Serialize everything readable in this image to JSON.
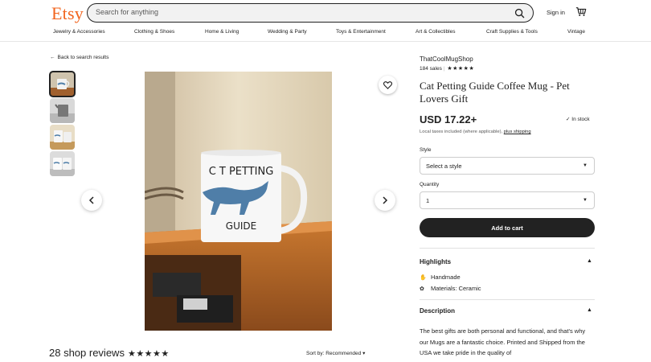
{
  "header": {
    "logo": "Etsy",
    "search_placeholder": "Search for anything",
    "sign_in": "Sign in"
  },
  "categories": [
    "Jewelry & Accessories",
    "Clothing & Shoes",
    "Home & Living",
    "Wedding & Party",
    "Toys & Entertainment",
    "Art & Collectibles",
    "Craft Supplies & Tools",
    "Vintage"
  ],
  "listing": {
    "back_link": "Back to search results",
    "thumbnails_count": 4,
    "mug_text_top": "C T PETTING",
    "mug_text_bottom": "GUIDE"
  },
  "reviews": {
    "title": "28 shop reviews",
    "stars": "★★★★★",
    "sort_label": "Sort by: Recommended"
  },
  "product": {
    "shop_name": "ThatCoolMugShop",
    "sales": "184 sales",
    "stars": "★★★★★",
    "title": "Cat Petting Guide Coffee Mug - Pet Lovers Gift",
    "price": "USD 17.22+",
    "in_stock": "In stock",
    "taxes_text": "Local taxes included (where applicable),",
    "shipping_link": "plus shipping",
    "style_label": "Style",
    "style_value": "Select a style",
    "quantity_label": "Quantity",
    "quantity_value": "1",
    "add_to_cart": "Add to cart"
  },
  "highlights": {
    "heading": "Highlights",
    "items": [
      "Handmade",
      "Materials: Ceramic"
    ]
  },
  "description": {
    "heading": "Description",
    "text": "The best gifts are both personal and functional, and that's why our Mugs are a fantastic choice. Printed and Shipped from the USA we take pride in the quality of"
  }
}
